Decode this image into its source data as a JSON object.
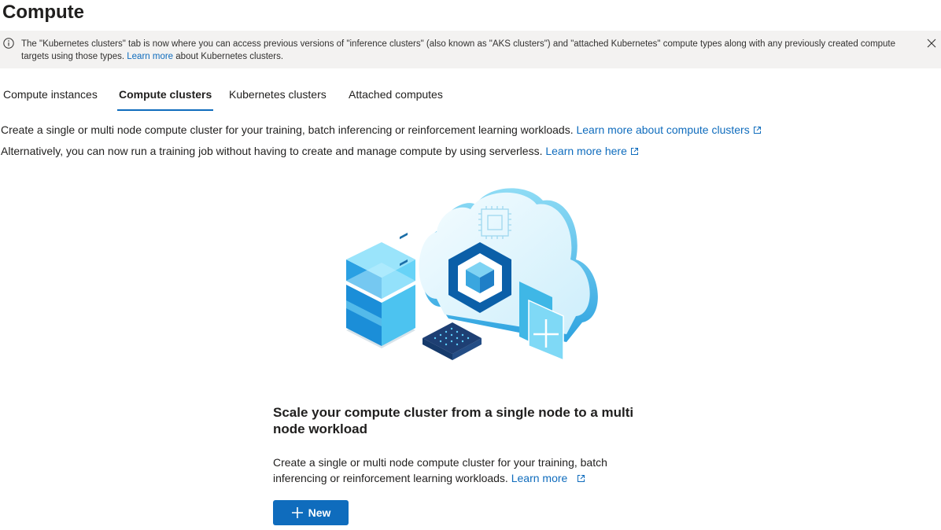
{
  "page": {
    "title": "Compute"
  },
  "banner": {
    "text_before": "The \"Kubernetes clusters\" tab is now where you can access previous versions of \"inference clusters\" (also known as \"AKS clusters\") and \"attached Kubernetes\" compute types along with any previously created compute targets using those types.",
    "link": "Learn more",
    "text_after": "about Kubernetes clusters."
  },
  "tabs": [
    {
      "label": "Compute instances",
      "active": false
    },
    {
      "label": "Compute clusters",
      "active": true
    },
    {
      "label": "Kubernetes clusters",
      "active": false
    },
    {
      "label": "Attached computes",
      "active": false
    }
  ],
  "description": {
    "line1_text": "Create a single or multi node compute cluster for your training, batch inferencing or reinforcement learning workloads.",
    "line1_link": "Learn more about compute clusters",
    "line2_text": "Alternatively, you can now run a training job without having to create and manage compute by using serverless.",
    "line2_link": "Learn more here"
  },
  "empty_state": {
    "title": "Scale your compute cluster from a single node to a multi node workload",
    "description": "Create a single or multi node compute cluster for your training, batch inferencing or reinforcement learning workloads.",
    "link": "Learn more",
    "button_label": "New"
  },
  "icons": {
    "info": "info-icon",
    "close": "close-icon",
    "external": "external-link-icon",
    "add": "plus-icon"
  },
  "colors": {
    "accent": "#0f6cbd",
    "banner_bg": "#f3f2f1"
  }
}
